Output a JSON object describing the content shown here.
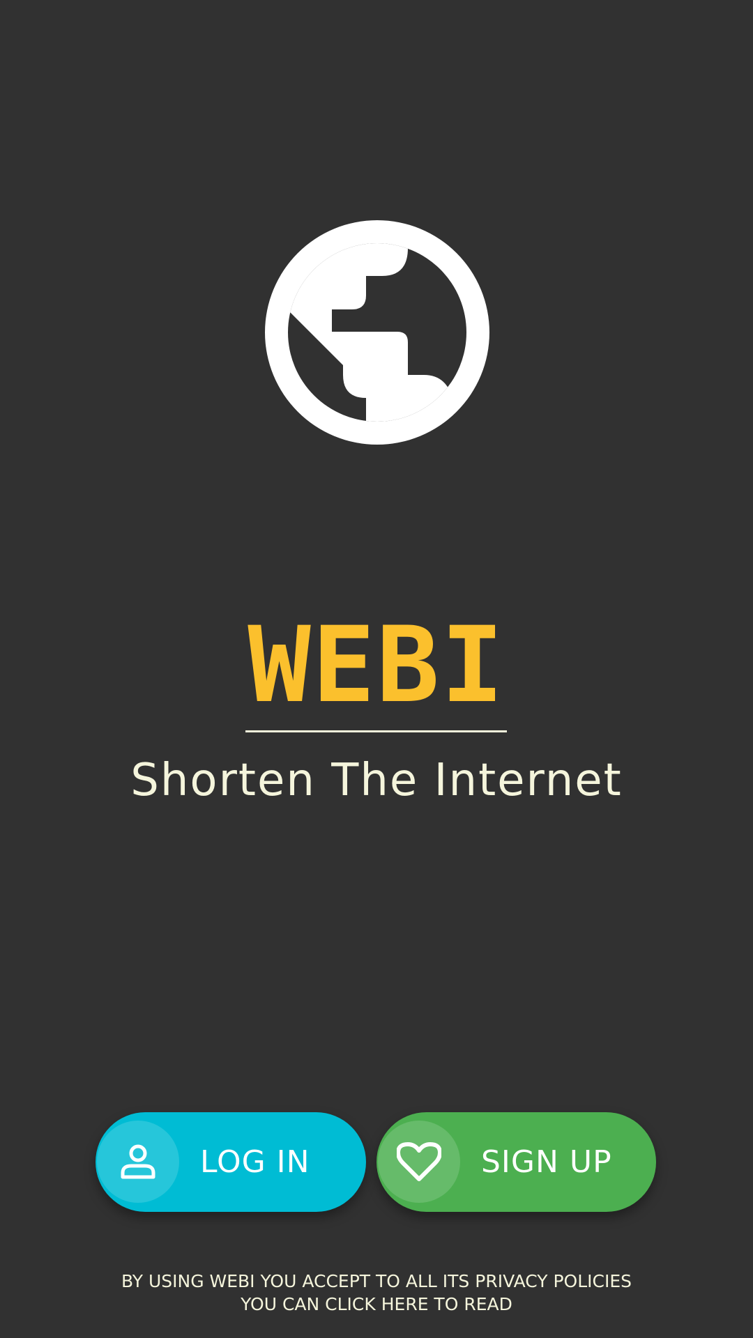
{
  "app": {
    "brand": "WEBI",
    "tagline": "Shorten The Internet"
  },
  "buttons": {
    "login_label": "LOG IN",
    "signup_label": "SIGN UP"
  },
  "footer": {
    "line1": "BY USING WEBI YOU ACCEPT TO ALL ITS PRIVACY POLICIES",
    "line2": "YOU CAN CLICK HERE TO READ"
  },
  "icons": {
    "logo": "globe-icon",
    "login": "person-icon",
    "signup": "heart-icon"
  },
  "colors": {
    "background": "#313131",
    "brand": "#FBC02D",
    "text": "#F5F5DC",
    "login": "#00BCD4",
    "signup": "#4CAF50"
  }
}
